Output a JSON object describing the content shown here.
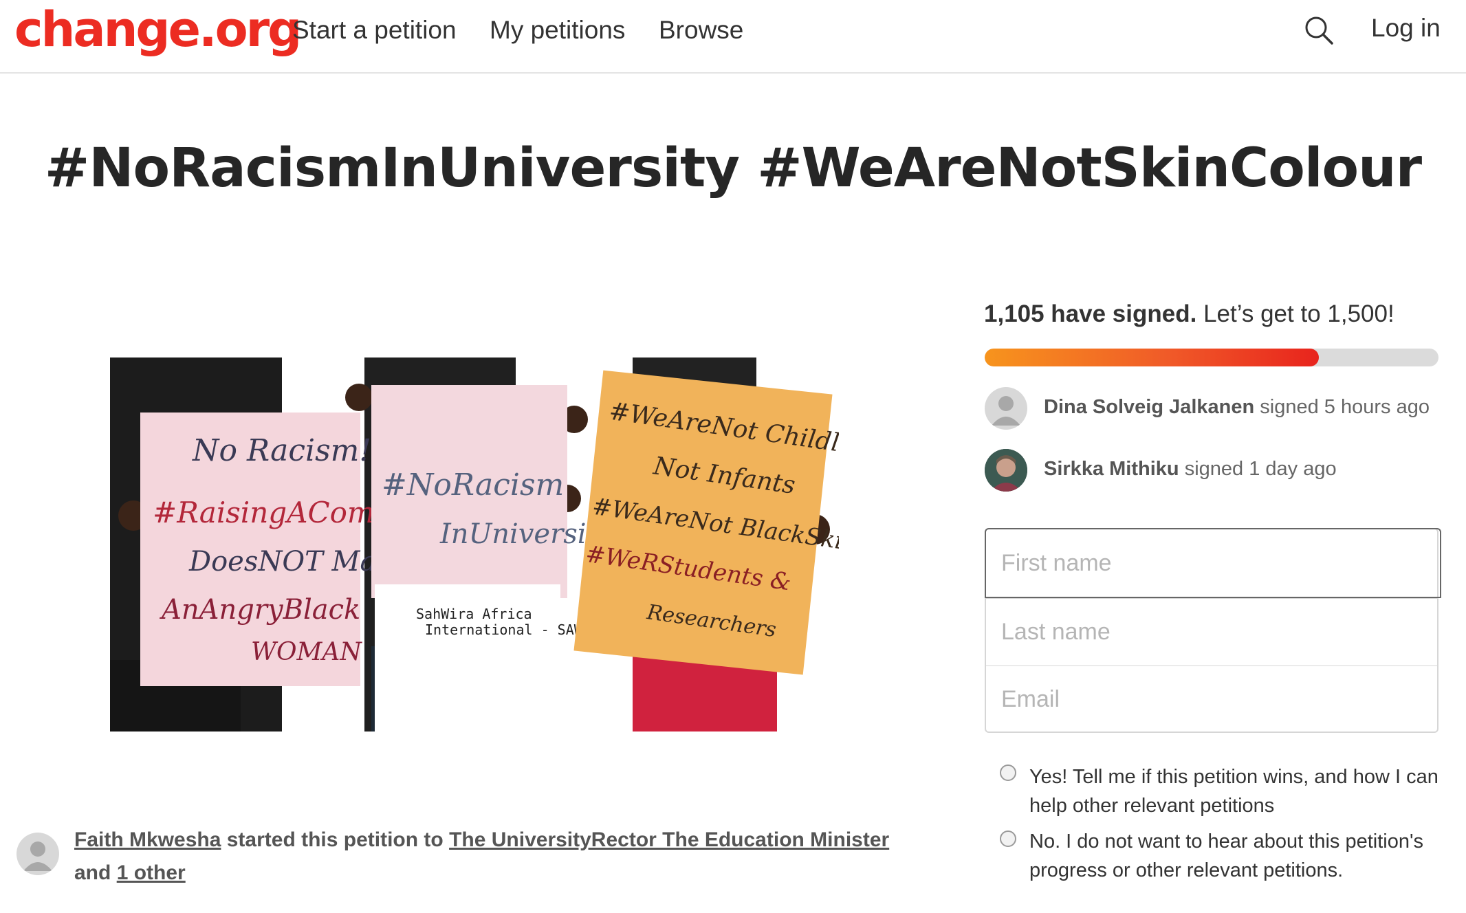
{
  "header": {
    "logo": "change.org",
    "nav": {
      "start": "Start a petition",
      "mine": "My petitions",
      "browse": "Browse"
    },
    "search_icon": "search-icon",
    "login": "Log in"
  },
  "petition": {
    "title": "#NoRacismInUniversity #WeAreNotSkinColour",
    "image_signs": {
      "left": [
        "No Racism!",
        "#RaisingAComplaint",
        "DoesNOT Make",
        "AnAngryBlack",
        "WOMAN"
      ],
      "middle": [
        "#NoRacism",
        "InUniversity"
      ],
      "right": [
        "#WeAreNot Childlike",
        "Not Infants",
        "#WeAreNot BlackSkinned",
        "#WeRStudents &",
        "Researchers"
      ],
      "watermark": [
        "SahWira Africa",
        "International - SAW"
      ]
    },
    "starter": {
      "name": "Faith Mkwesha",
      "started_text": "started this petition to",
      "targets": "The UniversityRector The Education Minister",
      "and_text": "and",
      "others": "1 other"
    }
  },
  "signatures": {
    "count_text": "1,105 have signed.",
    "goal_text": "Let’s get to 1,500!",
    "count": 1105,
    "goal": 1500,
    "progress_fraction": 0.7367,
    "recent": [
      {
        "name": "Dina Solveig Jalkanen",
        "action": "signed 5 hours ago"
      },
      {
        "name": "Sirkka Mithiku",
        "action": "signed 1 day ago"
      }
    ]
  },
  "form": {
    "first_name_placeholder": "First name",
    "last_name_placeholder": "Last name",
    "email_placeholder": "Email",
    "opt_in_label": "Yes! Tell me if this petition wins, and how I can help other relevant petitions",
    "opt_out_label": "No. I do not want to hear about this petition's progress or other relevant petitions."
  },
  "colors": {
    "brand": "#ec2c22",
    "progress_start": "#f7941d",
    "progress_end": "#e8241d",
    "text": "#333333"
  }
}
